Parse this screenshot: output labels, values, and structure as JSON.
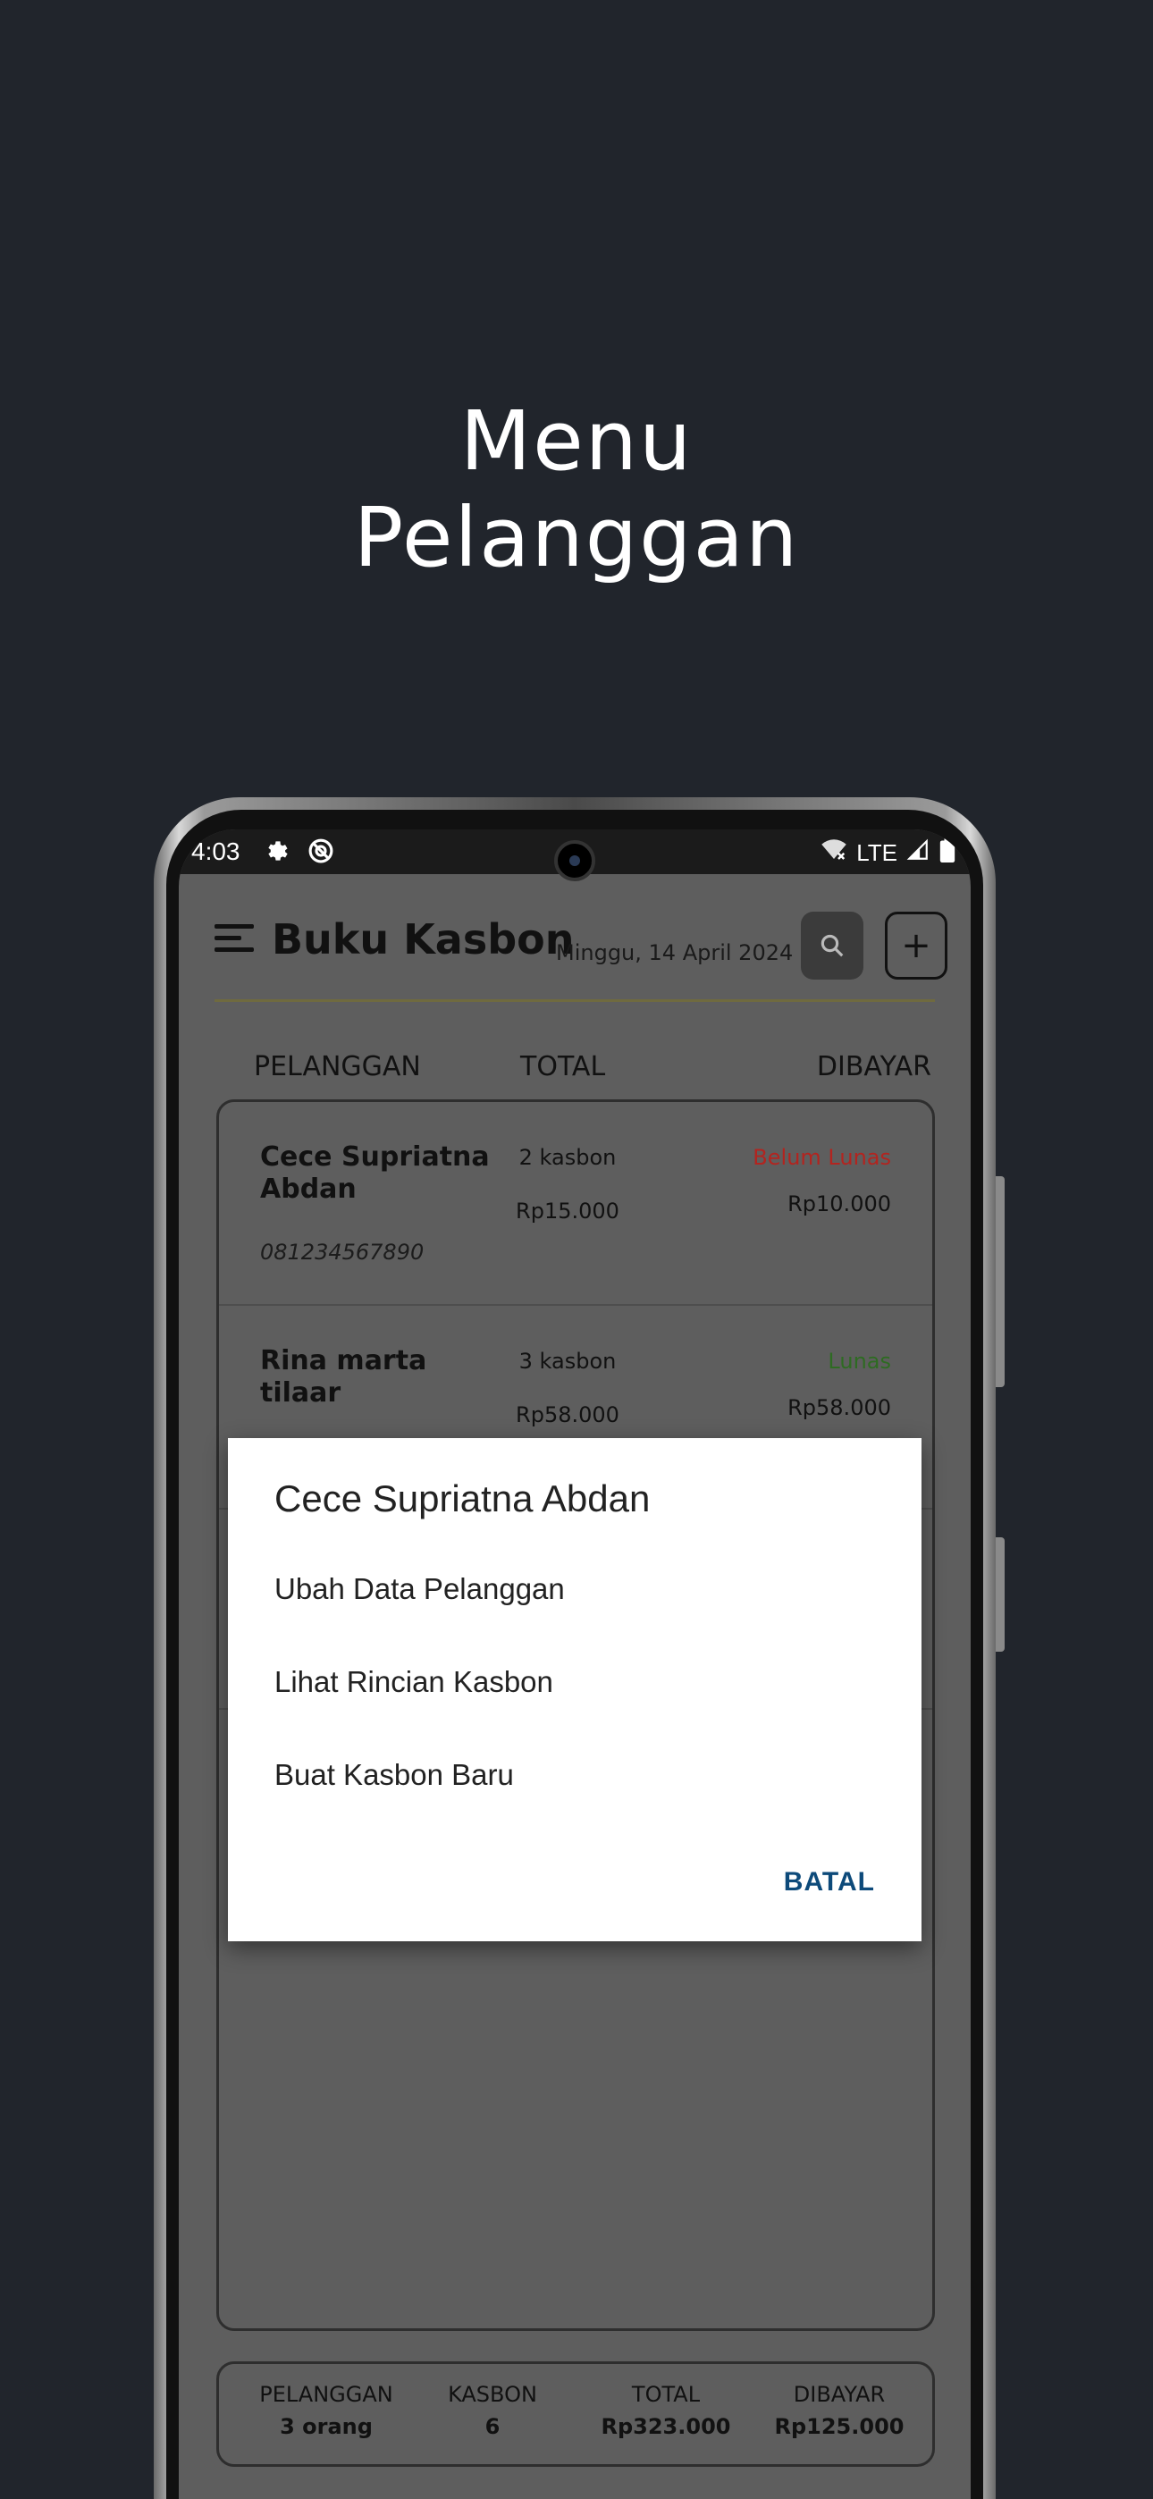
{
  "promo": {
    "title_line1": "Menu",
    "title_line2": "Pelanggan"
  },
  "statusbar": {
    "time": "4:03",
    "network": "LTE"
  },
  "app": {
    "title": "Buku Kasbon",
    "date": "Minggu, 14 April 2024",
    "add_symbol": "+",
    "columns": {
      "customer": "PELANGGAN",
      "total": "TOTAL",
      "paid": "DIBAYAR"
    },
    "rows": [
      {
        "name": "Cece Supriatna Abdan",
        "phone": "081234567890",
        "count": "2 kasbon",
        "total": "Rp15.000",
        "status": "Belum Lunas",
        "status_color": "#b3241f",
        "paid": "Rp10.000"
      },
      {
        "name": "Rina marta tilaar",
        "phone": "",
        "count": "3 kasbon",
        "total": "Rp58.000",
        "status": "Lunas",
        "status_color": "#2e6b22",
        "paid": "Rp58.000"
      }
    ],
    "summary": [
      {
        "label": "PELANGGAN",
        "value": "3 orang"
      },
      {
        "label": "KASBON",
        "value": "6"
      },
      {
        "label": "TOTAL",
        "value": "Rp323.000"
      },
      {
        "label": "DIBAYAR",
        "value": "Rp125.000"
      }
    ]
  },
  "dialog": {
    "title": "Cece Supriatna Abdan",
    "items": [
      "Ubah Data Pelanggan",
      "Lihat Rincian Kasbon",
      "Buat Kasbon Baru"
    ],
    "cancel": "BATAL"
  },
  "icons": [
    "menu-icon",
    "gear-icon",
    "blocked-icon",
    "search-icon",
    "wifi-icon",
    "signal-icon",
    "battery-icon"
  ],
  "colors": {
    "background": "#21252c",
    "dialog_action": "#0d4a7a",
    "unpaid": "#b3241f",
    "paid": "#2e6b22"
  }
}
